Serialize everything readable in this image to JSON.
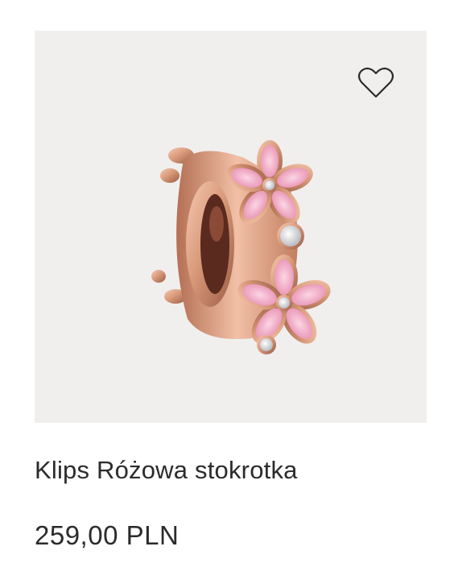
{
  "product": {
    "title": "Klips Różowa stokrotka",
    "price": "259,00 PLN",
    "wishlist_icon": "heart-outline-icon",
    "image_subject": "rose-gold-clip-charm"
  },
  "colors": {
    "image_background": "#f0efee",
    "text": "#2b2b2b",
    "rose_gold": "#d99a7a",
    "petal_pink": "#f2b6cc"
  }
}
